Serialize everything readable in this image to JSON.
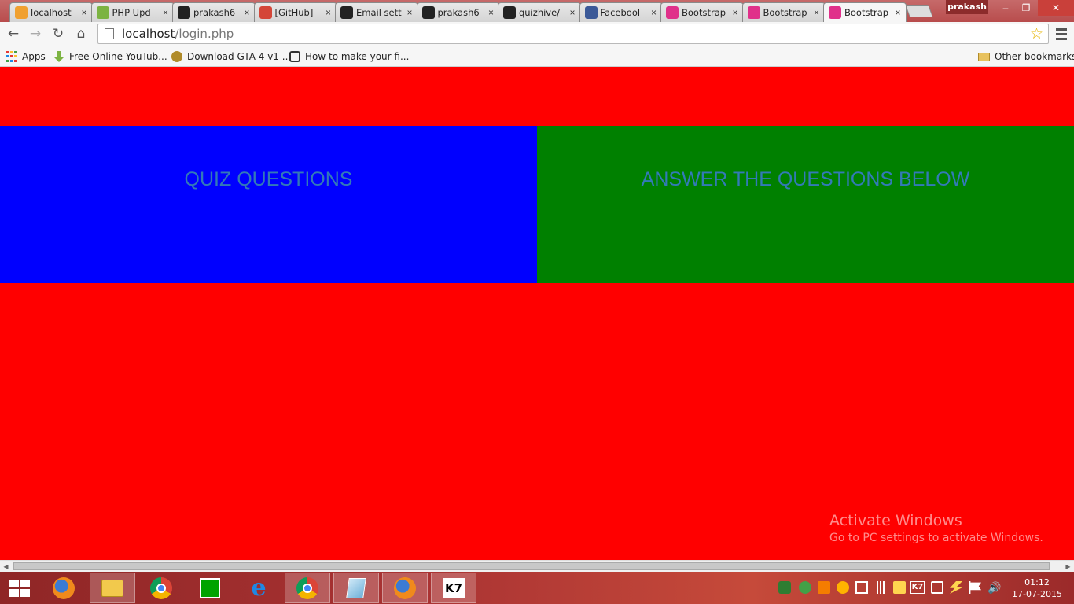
{
  "browser": {
    "tabs": [
      {
        "title": "localhost",
        "favicon": "phpmyadmin-icon",
        "color": "#f0a030"
      },
      {
        "title": "PHP Upd",
        "favicon": "php-icon",
        "color": "#7cb342"
      },
      {
        "title": "prakash6",
        "favicon": "github-icon",
        "color": "#222222"
      },
      {
        "title": "[GitHub]",
        "favicon": "gmail-icon",
        "color": "#d44638"
      },
      {
        "title": "Email sett",
        "favicon": "github-icon",
        "color": "#222222"
      },
      {
        "title": "prakash6",
        "favicon": "github-icon",
        "color": "#222222"
      },
      {
        "title": "quizhive/",
        "favicon": "github-icon",
        "color": "#222222"
      },
      {
        "title": "Facebool",
        "favicon": "facebook-icon",
        "color": "#3b5998"
      },
      {
        "title": "Bootstrap",
        "favicon": "bootstrap-icon",
        "color": "#e0308a"
      },
      {
        "title": "Bootstrap",
        "favicon": "bootstrap-icon",
        "color": "#e0308a"
      },
      {
        "title": "Bootstrap",
        "favicon": "bootstrap-icon",
        "color": "#e0308a"
      }
    ],
    "active_tab_index": 10,
    "profile_name": "prakash",
    "url_host": "localhost",
    "url_path": "/login.php",
    "bookmarks": [
      {
        "label": "Apps"
      },
      {
        "label": "Free Online YouTub..."
      },
      {
        "label": "Download GTA 4 v1 ..."
      },
      {
        "label": "How to make your fi..."
      }
    ],
    "other_bookmarks": "Other bookmarks"
  },
  "page": {
    "background": "#ff0000",
    "left_panel": {
      "heading": "QUIZ QUESTIONS",
      "background": "#0000ff"
    },
    "right_panel": {
      "heading": "ANSWER THE QUESTIONS BELOW",
      "background": "#008000"
    },
    "heading_color": "#337ab7"
  },
  "watermark": {
    "title": "Activate Windows",
    "subtitle": "Go to PC settings to activate Windows."
  },
  "taskbar": {
    "pinned": [
      {
        "name": "firefox"
      },
      {
        "name": "file-explorer"
      },
      {
        "name": "chrome"
      },
      {
        "name": "windows-store"
      },
      {
        "name": "internet-explorer"
      },
      {
        "name": "chrome-running"
      },
      {
        "name": "notepad-plus"
      },
      {
        "name": "firefox-running"
      },
      {
        "name": "k7-antivirus"
      }
    ],
    "time": "01:12",
    "date": "17-07-2015"
  }
}
